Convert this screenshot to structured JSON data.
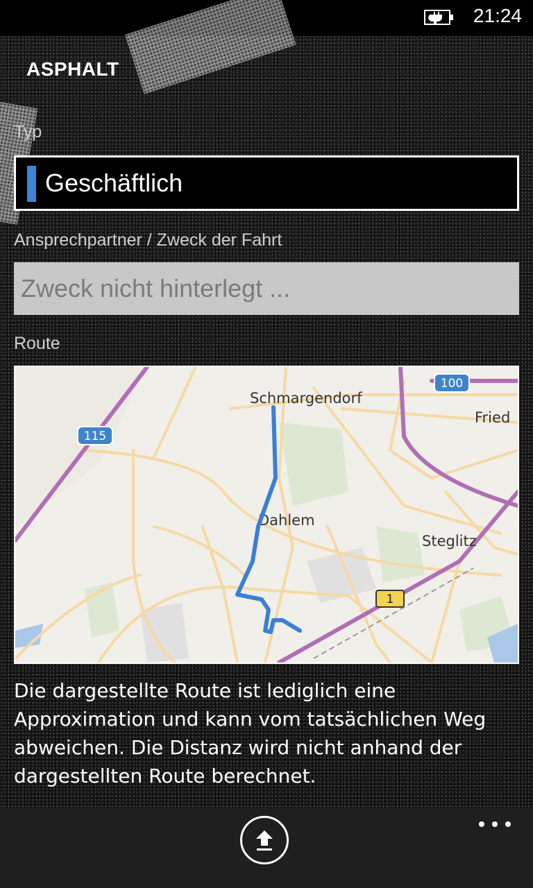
{
  "status": {
    "time": "21:24",
    "battery_icon": "battery-charging-icon"
  },
  "app": {
    "title": "ASPHALT"
  },
  "form": {
    "type_label": "Typ",
    "type_value": "Geschäftlich",
    "purpose_label": "Ansprechpartner / Zweck der Fahrt",
    "purpose_placeholder": "Zweck nicht hinterlegt ...",
    "route_label": "Route"
  },
  "map": {
    "places": [
      "Schmargendorf",
      "Dahlem",
      "Steglitz",
      "Fried"
    ],
    "shields": [
      "115",
      "100",
      "1"
    ]
  },
  "disclaimer": "Die dargestellte Route ist lediglich eine Approximation und kann vom tatsächlichen Weg abweichen. Die Distanz wird nicht anhand der dargestellten Route berechnet.",
  "appbar": {
    "upload_icon": "upload-icon",
    "more_icon": "more-icon"
  },
  "colors": {
    "accent": "#3d85d4",
    "route": "#3a7fd5"
  }
}
